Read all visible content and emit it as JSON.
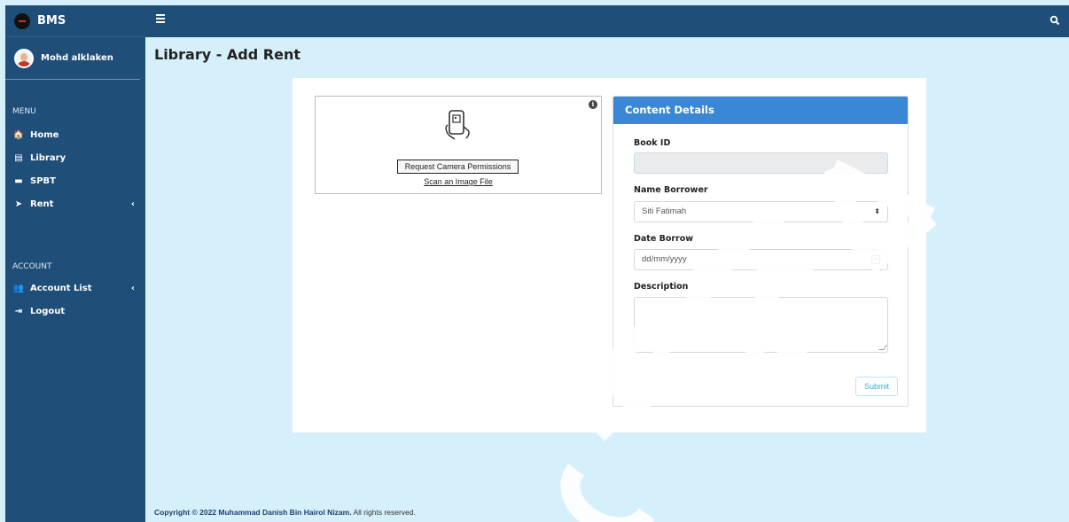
{
  "brand": {
    "name": "BMS"
  },
  "user": {
    "name": "Mohd alklaken"
  },
  "sidebar": {
    "menu_label": "MENU",
    "items": [
      {
        "label": "Home",
        "icon": "home-icon",
        "glyph": "🏠"
      },
      {
        "label": "Library",
        "icon": "library-icon",
        "glyph": "▤"
      },
      {
        "label": "SPBT",
        "icon": "spbt-icon",
        "glyph": "▬"
      },
      {
        "label": "Rent",
        "icon": "send-icon",
        "glyph": "➤",
        "chevron": "‹"
      }
    ],
    "account_label": "ACCOUNT",
    "account_items": [
      {
        "label": "Account List",
        "icon": "users-icon",
        "glyph": "👥",
        "chevron": "‹"
      },
      {
        "label": "Logout",
        "icon": "logout-icon",
        "glyph": "⇥"
      }
    ]
  },
  "page": {
    "title": "Library - Add Rent"
  },
  "scanner": {
    "camera_button": "Request Camera Permissions",
    "scan_link": "Scan an Image File",
    "info_glyph": "i"
  },
  "details": {
    "header": "Content Details",
    "book_id_label": "Book ID",
    "book_id_value": "",
    "borrower_label": "Name Borrower",
    "borrower_value": "Siti Fatimah",
    "date_label": "Date Borrow",
    "date_placeholder": "dd/mm/yyyy",
    "description_label": "Description",
    "submit_label": "Submit"
  },
  "footer": {
    "prefix": "Copyright © 2022 Muhammad Danish Bin Hairol Nizam.",
    "suffix": " All rights reserved."
  },
  "watermark": {
    "text": "@FTSM"
  },
  "colors": {
    "sidebar": "#1f4e79",
    "background": "#d6f0fb",
    "card_header": "#3a87d6",
    "accent": "#3aa7d8"
  }
}
